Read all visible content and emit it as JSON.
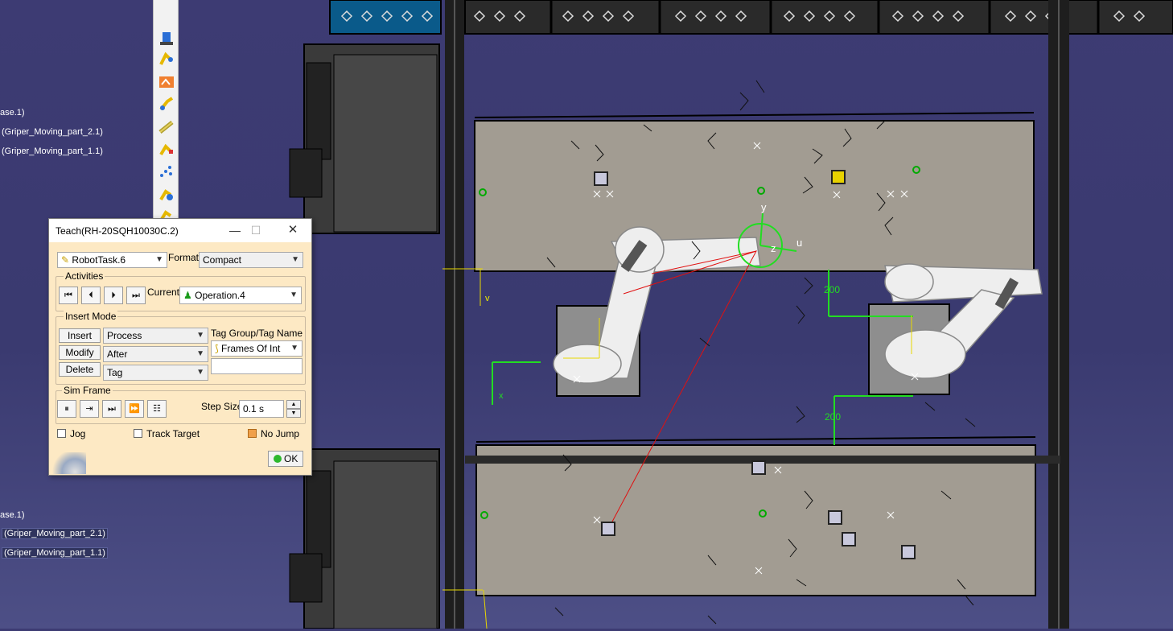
{
  "tree": {
    "labels": [
      "ase.1)",
      "(Griper_Moving_part_2.1)",
      "(Griper_Moving_part_1.1)",
      "ase.1)",
      "(Griper_Moving_part_2.1)",
      "(Griper_Moving_part_1.1)"
    ]
  },
  "toolbar": {
    "icons": [
      "teach-device-icon",
      "robot-task-icon",
      "robot-program-icon",
      "tag-icon",
      "gripper-icon",
      "robot-motion-icon",
      "tag-group-icon",
      "simulation-icon",
      "robot-jog-icon"
    ]
  },
  "viewport": {
    "dim_top": "200",
    "dim_bottom": "200",
    "axes": {
      "u": "u",
      "v": "v",
      "y": "y",
      "z": "z",
      "x": "x"
    }
  },
  "dialog": {
    "title": "Teach(RH-20SQH10030C.2)",
    "minimize": "—",
    "maximize": "☐",
    "close": "✕",
    "task": "RobotTask.6",
    "format_label": "Format",
    "format_value": "Compact",
    "activities_title": "Activities",
    "current_label": "Current",
    "current_value": "Operation.4",
    "insert_mode_title": "Insert Mode",
    "insert_btn": "Insert",
    "modify_btn": "Modify",
    "delete_btn": "Delete",
    "mode_process": "Process",
    "mode_after": "After",
    "mode_tag": "Tag",
    "tag_group_label": "Tag Group/Tag Name",
    "tag_group_value": "Frames Of Int",
    "tag_name_value": "",
    "sim_frame_title": "Sim Frame",
    "step_size_label": "Step Size",
    "step_size_value": "0.1 s",
    "jog_label": "Jog",
    "track_target_label": "Track Target",
    "no_jump_label": "No Jump",
    "ok_label": "OK",
    "jog_checked": false,
    "track_target_checked": false,
    "no_jump_checked": true
  }
}
